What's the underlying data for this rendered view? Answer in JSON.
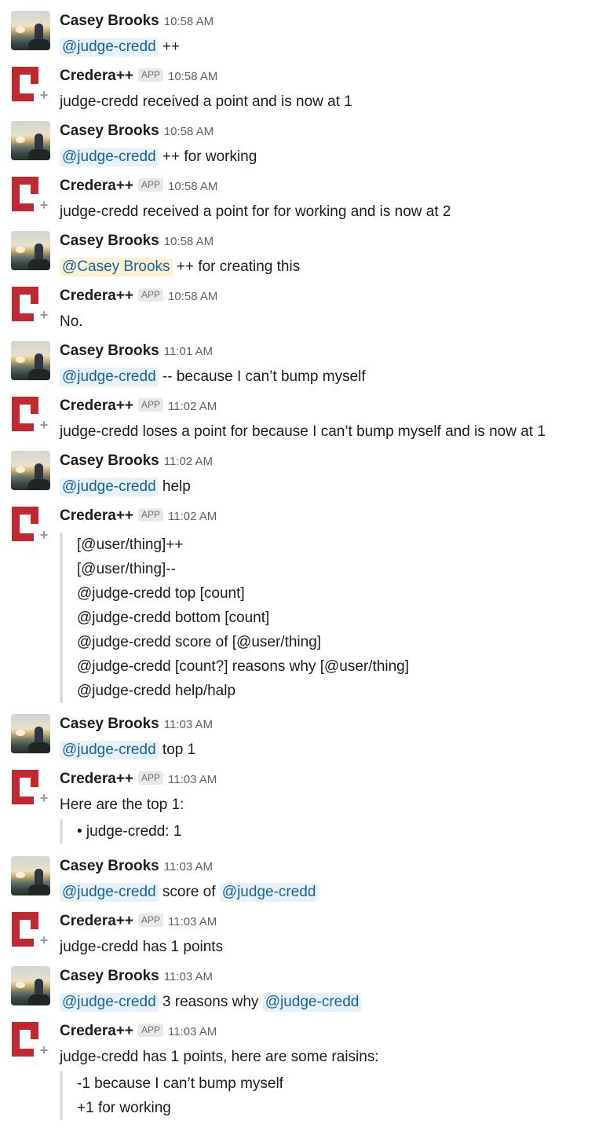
{
  "colors": {
    "mention_bg": "#e8f1f9",
    "mention_text": "#1264a3",
    "self_mention_bg": "#fcf0d3",
    "bot_logo_red": "#c3272f",
    "quote_border": "#dddddd"
  },
  "messages": [
    {
      "sender": "Casey Brooks",
      "time": "10:58 AM",
      "mention1": "@judge-credd",
      "text1": "++"
    },
    {
      "sender": "Credera++",
      "badge": "APP",
      "time": "10:58 AM",
      "text1": "judge-credd received a point and is now at 1"
    },
    {
      "sender": "Casey Brooks",
      "time": "10:58 AM",
      "mention1": "@judge-credd",
      "text1": "++ for working"
    },
    {
      "sender": "Credera++",
      "badge": "APP",
      "time": "10:58 AM",
      "text1": "judge-credd received a point for for working and is now at 2"
    },
    {
      "sender": "Casey Brooks",
      "time": "10:58 AM",
      "mention1": "@Casey Brooks",
      "text1": "++ for creating this"
    },
    {
      "sender": "Credera++",
      "badge": "APP",
      "time": "10:58 AM",
      "text1": "No."
    },
    {
      "sender": "Casey Brooks",
      "time": "11:01 AM",
      "mention1": "@judge-credd",
      "text1": "-- because I can’t bump myself"
    },
    {
      "sender": "Credera++",
      "badge": "APP",
      "time": "11:02 AM",
      "text1": "judge-credd loses a point for because I can’t bump myself and is now at 1"
    },
    {
      "sender": "Casey Brooks",
      "time": "11:02 AM",
      "mention1": "@judge-credd",
      "text1": "help"
    },
    {
      "sender": "Credera++",
      "badge": "APP",
      "time": "11:02 AM",
      "quote": [
        "[@user/thing]++",
        "[@user/thing]--",
        "@judge-credd top [count]",
        "@judge-credd bottom [count]",
        "@judge-credd score of [@user/thing]",
        "@judge-credd [count?] reasons why [@user/thing]",
        "@judge-credd help/halp"
      ]
    },
    {
      "sender": "Casey Brooks",
      "time": "11:03 AM",
      "mention1": "@judge-credd",
      "text1": "top 1"
    },
    {
      "sender": "Credera++",
      "badge": "APP",
      "time": "11:03 AM",
      "text1": "Here are the top 1:",
      "quote": [
        "• judge-credd: 1"
      ]
    },
    {
      "sender": "Casey Brooks",
      "time": "11:03 AM",
      "mention1": "@judge-credd",
      "text1": "score of",
      "mention2": "@judge-credd"
    },
    {
      "sender": "Credera++",
      "badge": "APP",
      "time": "11:03 AM",
      "text1": "judge-credd has 1 points"
    },
    {
      "sender": "Casey Brooks",
      "time": "11:03 AM",
      "mention1": "@judge-credd",
      "text1": "3 reasons why",
      "mention2": "@judge-credd"
    },
    {
      "sender": "Credera++",
      "badge": "APP",
      "time": "11:03 AM",
      "text1": "judge-credd has 1 points, here are some raisins:",
      "quote": [
        "-1 because I can’t bump myself",
        "+1 for working"
      ]
    }
  ]
}
